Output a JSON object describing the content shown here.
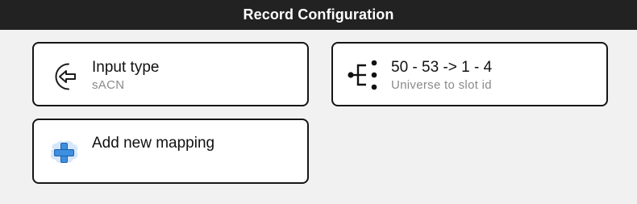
{
  "header": {
    "title": "Record Configuration"
  },
  "cards": {
    "input_type": {
      "title": "Input type",
      "subtitle": "sACN",
      "icon": "input-arrow-icon"
    },
    "mapping": {
      "title": "50 - 53 -> 1 - 4",
      "subtitle": "Universe to slot id",
      "icon": "tree-mapping-icon"
    },
    "add_mapping": {
      "title": "Add new mapping",
      "icon": "plus-icon"
    }
  },
  "colors": {
    "titlebar_bg": "#222222",
    "page_bg": "#f1f1f1",
    "card_border": "#161616",
    "plus_blue": "#3d8fe0",
    "plus_glow": "#cfe3fb"
  }
}
